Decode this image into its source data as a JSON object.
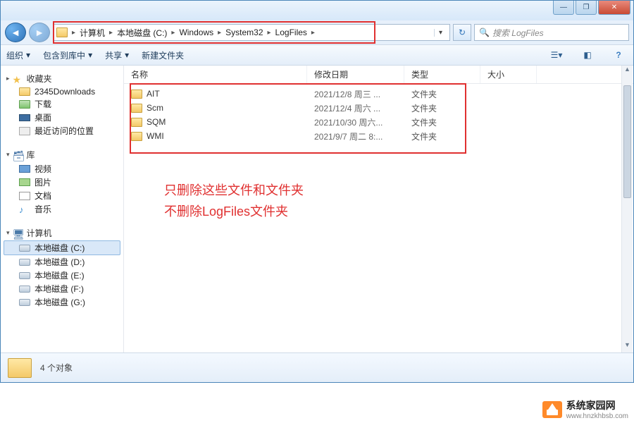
{
  "window_controls": {
    "min": "—",
    "max": "❐",
    "close": "✕"
  },
  "nav": {
    "back": "◄",
    "fwd": "►"
  },
  "breadcrumb": {
    "segs": [
      "计算机",
      "本地磁盘 (C:)",
      "Windows",
      "System32",
      "LogFiles"
    ],
    "dropdown": "▾"
  },
  "refresh": "↻",
  "search": {
    "icon": "🔍",
    "placeholder": "搜索 LogFiles"
  },
  "toolbar": {
    "organize": "组织",
    "include": "包含到库中",
    "share": "共享",
    "newfolder": "新建文件夹",
    "drop": "▾"
  },
  "sidebar": {
    "fav": {
      "tri": "▸",
      "label": "收藏夹"
    },
    "fav_items": [
      "2345Downloads",
      "下载",
      "桌面",
      "最近访问的位置"
    ],
    "lib": {
      "tri": "▾",
      "label": "库"
    },
    "lib_items": [
      "视频",
      "图片",
      "文档",
      "音乐"
    ],
    "comp": {
      "tri": "▾",
      "label": "计算机"
    },
    "drives": [
      "本地磁盘 (C:)",
      "本地磁盘 (D:)",
      "本地磁盘 (E:)",
      "本地磁盘 (F:)",
      "本地磁盘 (G:)"
    ]
  },
  "columns": {
    "name": "名称",
    "date": "修改日期",
    "type": "类型",
    "size": "大小"
  },
  "files": [
    {
      "name": "AIT",
      "date": "2021/12/8 周三 ...",
      "type": "文件夹"
    },
    {
      "name": "Scm",
      "date": "2021/12/4 周六 ...",
      "type": "文件夹"
    },
    {
      "name": "SQM",
      "date": "2021/10/30 周六...",
      "type": "文件夹"
    },
    {
      "name": "WMI",
      "date": "2021/9/7 周二 8:...",
      "type": "文件夹"
    }
  ],
  "annotation": {
    "line1": "只删除这些文件和文件夹",
    "line2": "不删除LogFiles文件夹"
  },
  "status": {
    "count": "4 个对象"
  },
  "watermark": {
    "title": "系统家园网",
    "url": "www.hnzkhbsb.com"
  }
}
